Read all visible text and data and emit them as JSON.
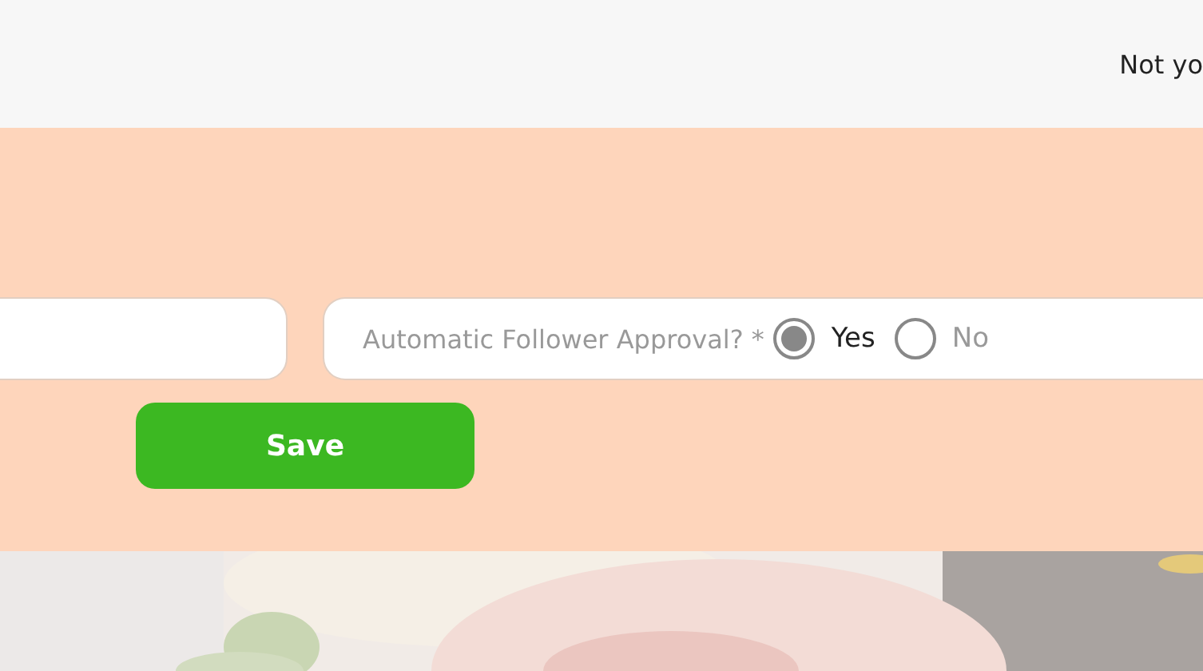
{
  "header": {
    "link": "Not yo"
  },
  "form": {
    "approval": {
      "label": "Automatic Follower Approval? *",
      "options": [
        {
          "label": "Yes",
          "selected": true
        },
        {
          "label": "No",
          "selected": false
        }
      ]
    },
    "save": "Save"
  }
}
